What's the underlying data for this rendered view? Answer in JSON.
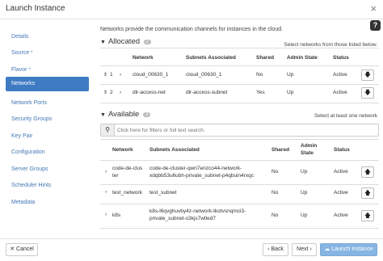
{
  "dialog": {
    "title": "Launch Instance"
  },
  "sidebar": {
    "items": [
      {
        "label": "Details",
        "required": false
      },
      {
        "label": "Source",
        "required": true
      },
      {
        "label": "Flavor",
        "required": true
      },
      {
        "label": "Networks",
        "required": true,
        "active": true
      },
      {
        "label": "Network Ports",
        "required": false
      },
      {
        "label": "Security Groups",
        "required": false
      },
      {
        "label": "Key Pair",
        "required": false
      },
      {
        "label": "Configuration",
        "required": false
      },
      {
        "label": "Server Groups",
        "required": false
      },
      {
        "label": "Scheduler Hints",
        "required": false
      },
      {
        "label": "Metadata",
        "required": false
      }
    ]
  },
  "networks": {
    "intro": "Networks provide the communication channels for instances in the cloud.",
    "allocated": {
      "title": "Allocated",
      "count": "2",
      "hint": "Select networks from those listed below.",
      "columns": [
        "Network",
        "Subnets Associated",
        "Shared",
        "Admin State",
        "Status"
      ],
      "rows": [
        {
          "order": "1",
          "network": "cloud_00630_1",
          "subnet": "cloud_00630_1",
          "shared": "No",
          "admin_state": "Up",
          "status": "Active"
        },
        {
          "order": "2",
          "network": "dlr-access-net",
          "subnet": "dlr-access-subnet",
          "shared": "Yes",
          "admin_state": "Up",
          "status": "Active"
        }
      ]
    },
    "available": {
      "title": "Available",
      "count": "3",
      "hint": "Select at least one network",
      "search_placeholder": "Click here for filters or full text search.",
      "columns": [
        "Network",
        "Subnets Associated",
        "Shared",
        "Admin State",
        "Status"
      ],
      "admin_state_line1": "Admin",
      "admin_state_line2": "State",
      "rows": [
        {
          "network_line1": "code-de-clus",
          "network_line2": "ter",
          "subnet_line1": "code-de-cluster-qwn7enzco44-network-",
          "subnet_line2": "xdqbb53u6ubh-private_subnet-p4qbuin4rxqc",
          "shared": "No",
          "admin_state": "Up",
          "status": "Active"
        },
        {
          "network_line1": "test_network",
          "network_line2": "",
          "subnet_line1": "test_subnet",
          "subnet_line2": "",
          "shared": "No",
          "admin_state": "Up",
          "status": "Active"
        },
        {
          "network_line1": "k8s",
          "network_line2": "",
          "subnet_line1": "k8s-l6qvghuvby4z-network-tkotvsnqmci3-",
          "subnet_line2": "private_subnet-s3kjs7wtled7",
          "shared": "No",
          "admin_state": "Up",
          "status": "Active"
        }
      ]
    }
  },
  "footer": {
    "cancel": "Cancel",
    "back": "Back",
    "next": "Next",
    "launch": "Launch Instance"
  },
  "icons": {
    "close": "close-icon",
    "help": "help-icon",
    "drag": "drag-handle-icon",
    "remove": "arrow-down-icon",
    "add": "arrow-up-icon",
    "search": "search-icon"
  },
  "colors": {
    "accent": "#3e7bc3",
    "link": "#4378b5",
    "primary_button": "#87b5e3"
  }
}
